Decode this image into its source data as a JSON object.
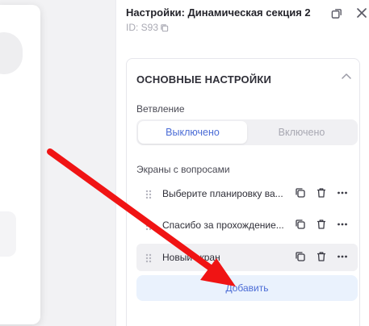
{
  "panel": {
    "title": "Настройки: Динамическая секция 2",
    "id_text": "ID: S93"
  },
  "main_settings": {
    "heading": "ОСНОВНЫЕ НАСТРОЙКИ",
    "branching_label": "Ветвление",
    "branching_options": [
      "Выключено",
      "Включено"
    ],
    "branching_selected": "Выключено",
    "screens_label": "Экраны с вопросами",
    "screens": [
      {
        "text": "Выберите планировку ва..."
      },
      {
        "text": "Спасибо за прохождение..."
      },
      {
        "text": "Новый экран"
      }
    ],
    "add_label": "Добавить"
  },
  "colors": {
    "accent": "#4b6cd6",
    "annotation_arrow": "#f01414"
  }
}
